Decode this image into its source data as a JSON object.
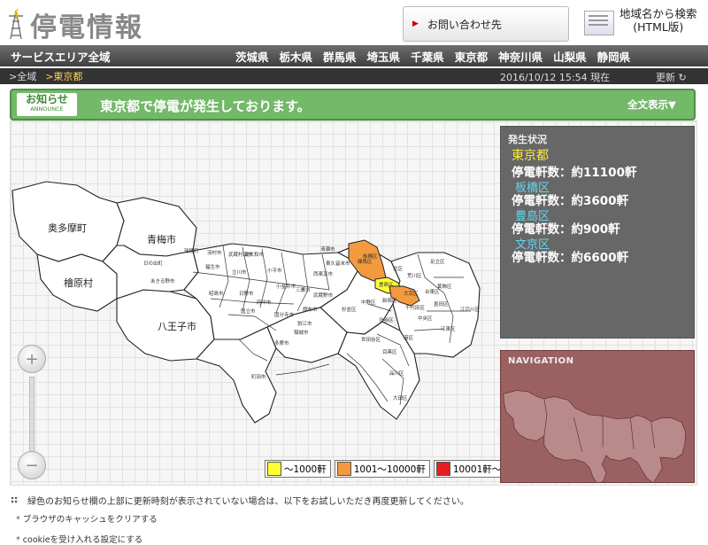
{
  "header": {
    "title": "停電情報",
    "contact_label": "お問い合わせ先",
    "area_search_line1": "地域名から検索",
    "area_search_line2": "(HTML版)"
  },
  "nav": {
    "all_label": "サービスエリア全域",
    "prefectures": [
      "茨城県",
      "栃木県",
      "群馬県",
      "埼玉県",
      "千葉県",
      "東京都",
      "神奈川県",
      "山梨県",
      "静岡県"
    ]
  },
  "subbar": {
    "crumb_all": ">全域",
    "crumb_current": ">東京都",
    "timestamp": "2016/10/12 15:54 現在",
    "refresh_label": "更新"
  },
  "announce": {
    "label_jp": "お知らせ",
    "label_en": "ANNOUNCE",
    "message": "東京都で停電が発生しております。",
    "more_label": "全文表示▼"
  },
  "status": {
    "title": "発生状況",
    "prefecture": "東京都",
    "total": "停電軒数：約11100軒",
    "wards": [
      {
        "name": "板橋区",
        "count": "停電軒数：約3600軒"
      },
      {
        "name": "豊島区",
        "count": "停電軒数：約900軒"
      },
      {
        "name": "文京区",
        "count": "停電軒数：約6600軒"
      }
    ]
  },
  "map": {
    "labels": [
      "奥多摩町",
      "青梅市",
      "檜原村",
      "八王子市"
    ],
    "small_labels": [
      "日の出町",
      "あきる野市",
      "瑞穂町",
      "羽村市",
      "福生市",
      "武蔵村山市",
      "東大和市",
      "立川市",
      "昭島市",
      "日野市",
      "国立市",
      "府中市",
      "小平市",
      "小金井市",
      "三鷹市",
      "調布市",
      "多摩市",
      "稲城市",
      "町田市",
      "清瀬市",
      "東久留米市",
      "西東京市",
      "練馬区",
      "板橋区",
      "北区",
      "足立区",
      "葛飾区",
      "荒川区",
      "豊島区",
      "文京区",
      "台東区",
      "墨田区",
      "江戸川区",
      "江東区",
      "中央区",
      "港区",
      "千代田区",
      "新宿区",
      "中野区",
      "杉並区",
      "渋谷区",
      "目黒区",
      "世田谷区",
      "品川区",
      "大田区",
      "狛江市",
      "国分寺市",
      "武蔵野市"
    ],
    "legend": [
      {
        "label": "～1000軒",
        "color": "#ffff33"
      },
      {
        "label": "1001～10000軒",
        "color": "#f39a3f"
      },
      {
        "label": "10001軒～",
        "color": "#e81e1e"
      }
    ],
    "highlight_colors": {
      "orange": "#f39a3f",
      "yellow": "#ffff33"
    },
    "navigation_title": "NAVIGATION"
  },
  "footer": {
    "note": "緑色のお知らせ欄の上部に更新時刻が表示されていない場合は、以下をお試しいただき再度更新してください。",
    "bullets": [
      "ブラウザのキャッシュをクリアする",
      "cookieを受け入れる設定にする"
    ]
  }
}
